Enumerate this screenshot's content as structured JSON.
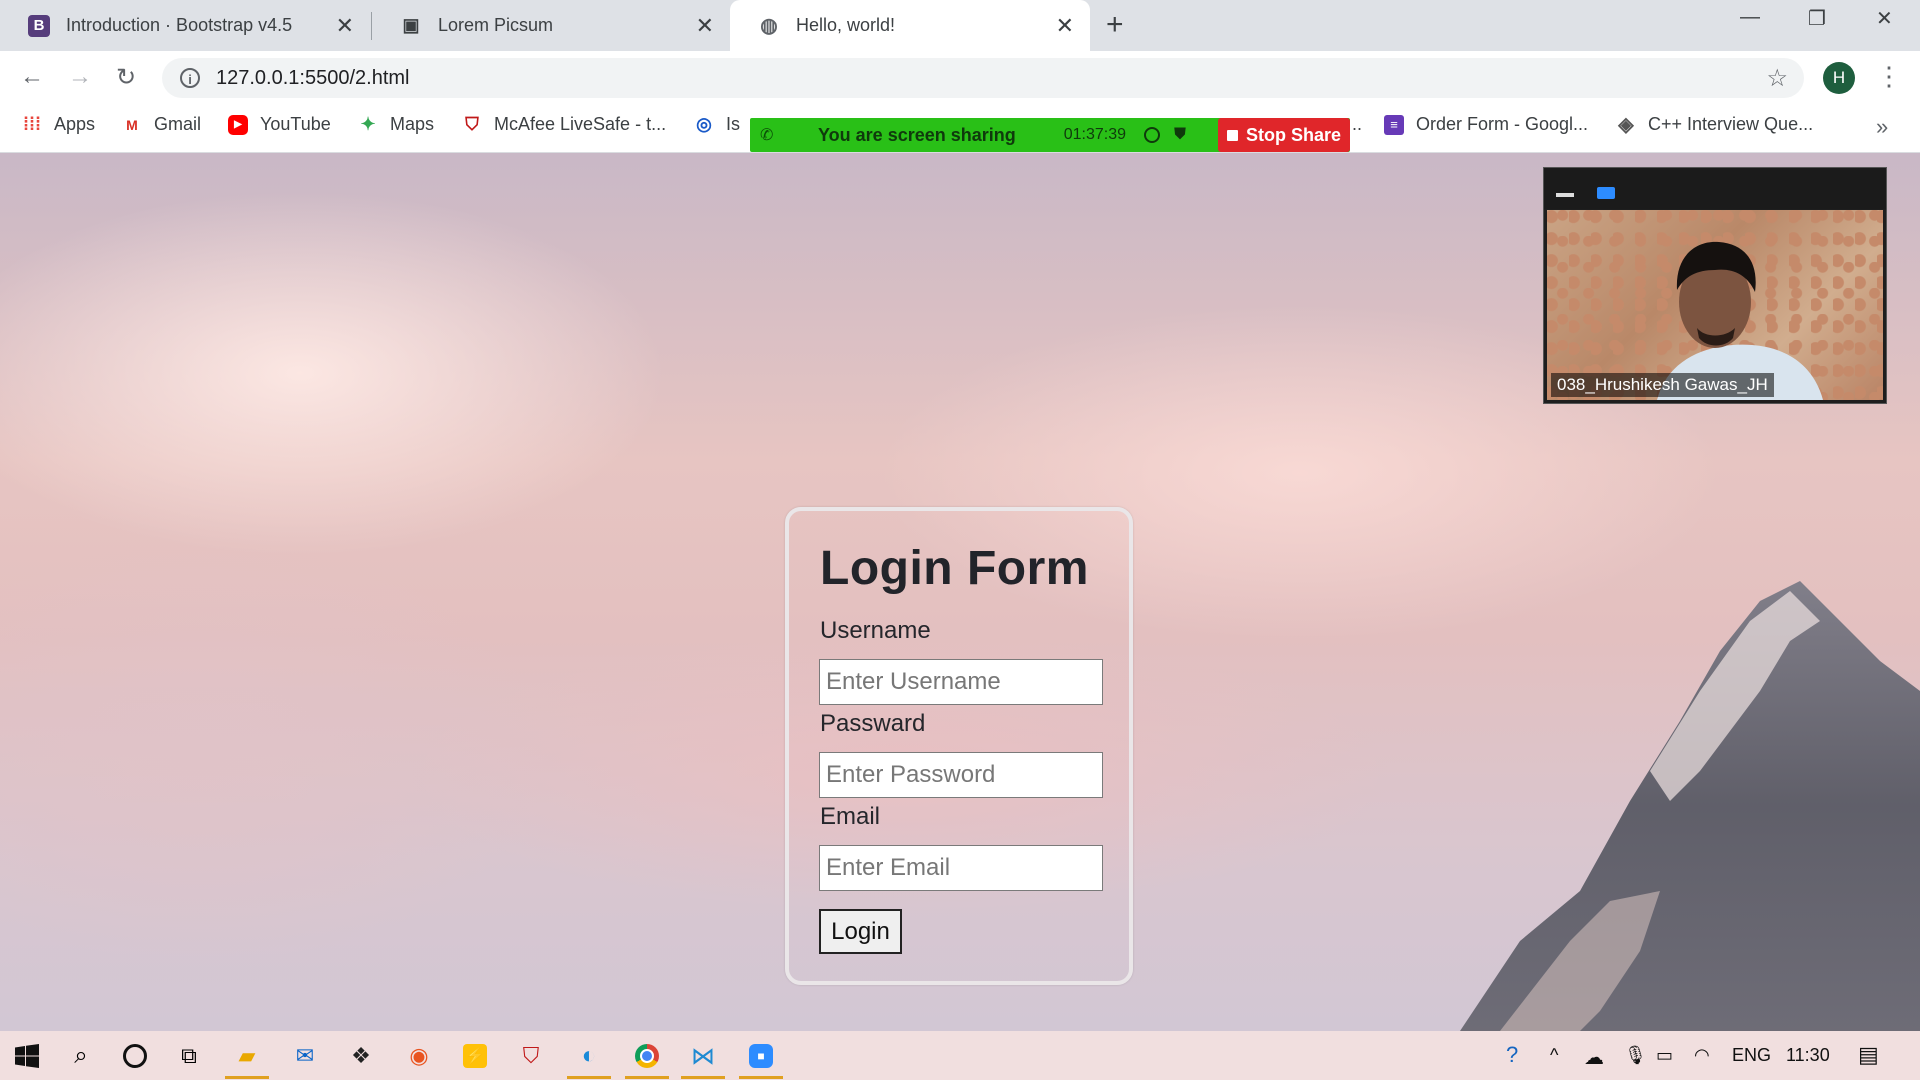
{
  "browser": {
    "tabs": [
      {
        "title": "Introduction · Bootstrap v4.5",
        "icon": "bootstrap-icon",
        "active": false
      },
      {
        "title": "Lorem Picsum",
        "icon": "image-icon",
        "active": false
      },
      {
        "title": "Hello, world!",
        "icon": "globe-icon",
        "active": true
      }
    ],
    "url": "127.0.0.1:5500/2.html",
    "profile_initial": "H",
    "bookmarks": [
      {
        "label": "Apps",
        "icon": "apps-grid-icon"
      },
      {
        "label": "Gmail",
        "icon": "gmail-icon"
      },
      {
        "label": "YouTube",
        "icon": "youtube-icon"
      },
      {
        "label": "Maps",
        "icon": "maps-icon"
      },
      {
        "label": "McAfee LiveSafe - t...",
        "icon": "mcafee-icon"
      },
      {
        "label": "Is",
        "icon": "site-icon"
      },
      {
        "label": "Order Form - Googl...",
        "icon": "forms-icon"
      },
      {
        "label": "C++ Interview Que...",
        "icon": "code-icon"
      }
    ],
    "bookmark_ellipsis": "..",
    "bookmarks_more": "»"
  },
  "zoom": {
    "share_message": "You are screen sharing",
    "timer": "01:37:39",
    "stop_label": "Stop Share",
    "participant_name": "038_Hrushikesh Gawas_JH"
  },
  "form": {
    "title": "Login Form",
    "username_label": "Username",
    "username_placeholder": "Enter Username",
    "password_label": "Passward",
    "password_placeholder": "Enter Password",
    "email_label": "Email",
    "email_placeholder": "Enter Email",
    "submit_label": "Login"
  },
  "taskbar": {
    "language": "ENG",
    "time": "11:30"
  },
  "colors": {
    "share_green": "#29c017",
    "stop_red": "#e0262a",
    "zoom_blue": "#2d8cff"
  }
}
